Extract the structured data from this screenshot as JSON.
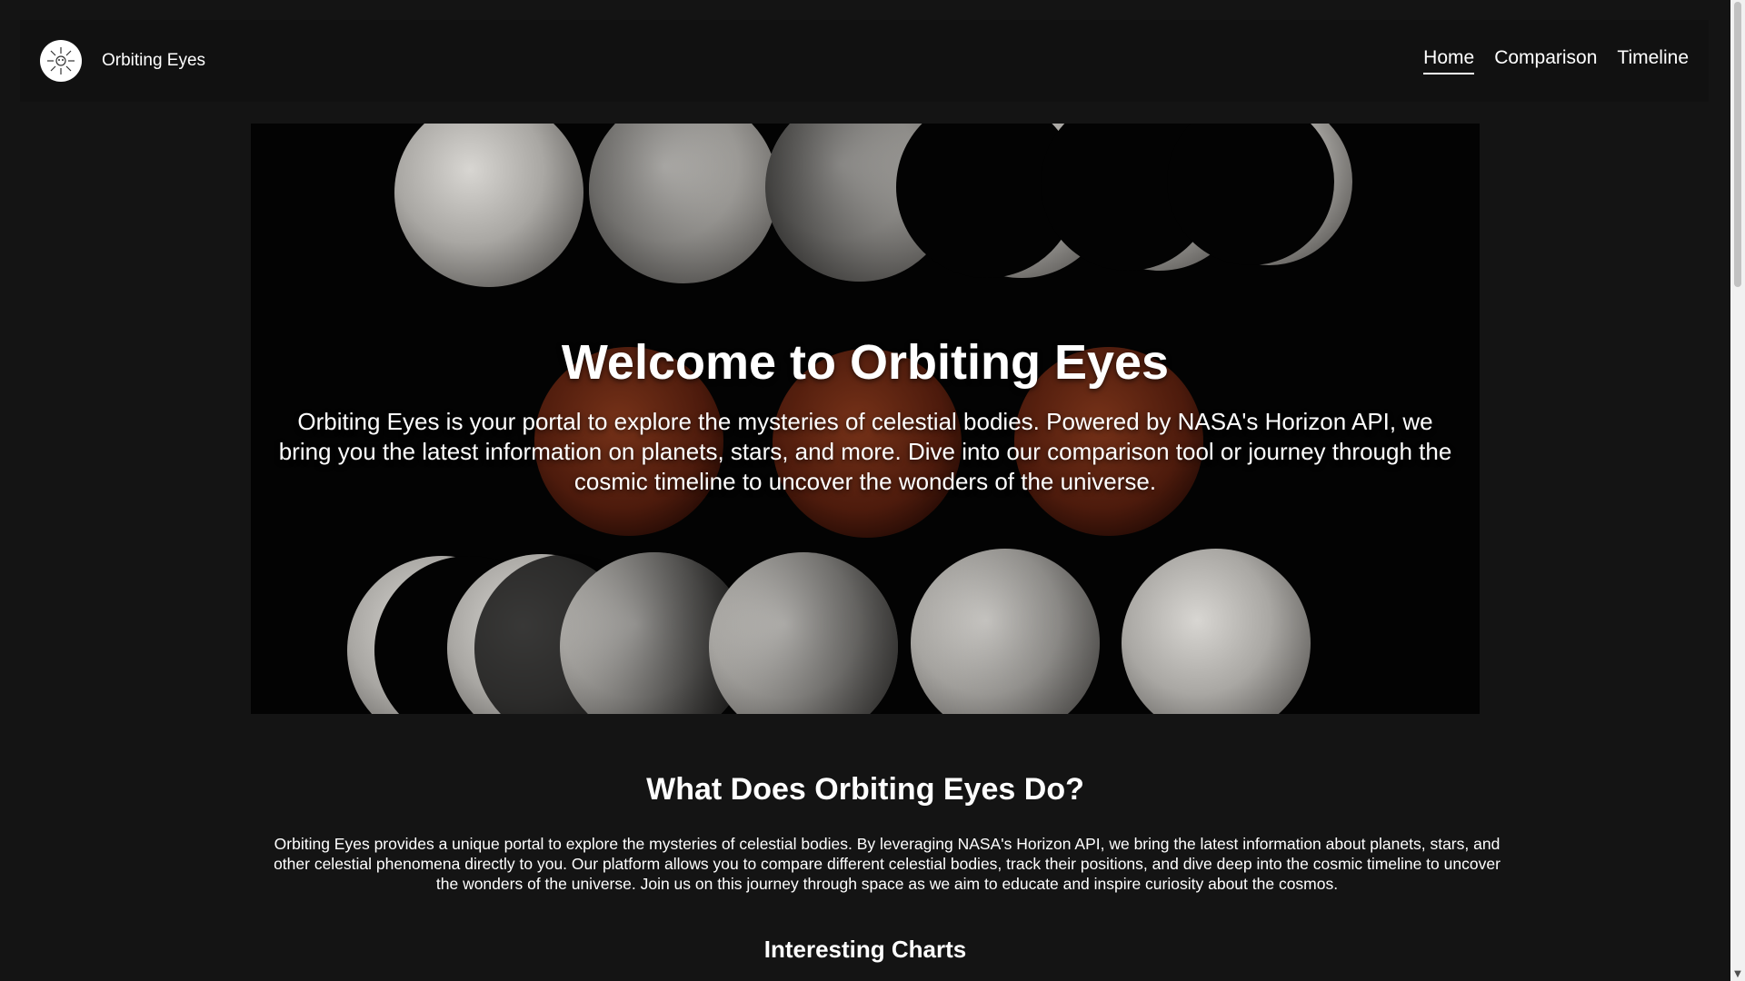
{
  "navbar": {
    "brand_name": "Orbiting Eyes",
    "logo_icon": "sun-emblem-icon",
    "links": [
      {
        "label": "Home",
        "active": true
      },
      {
        "label": "Comparison",
        "active": false
      },
      {
        "label": "Timeline",
        "active": false
      }
    ]
  },
  "hero": {
    "title": "Welcome to Orbiting Eyes",
    "description": "Orbiting Eyes is your portal to explore the mysteries of celestial bodies. Powered by NASA's Horizon API, we bring you the latest information on planets, stars, and more. Dive into our comparison tool or journey through the cosmic timeline to uncover the wonders of the universe.",
    "background_image": "lunar-eclipse-phases-image"
  },
  "about": {
    "title": "What Does Orbiting Eyes Do?",
    "description": "Orbiting Eyes provides a unique portal to explore the mysteries of celestial bodies. By leveraging NASA's Horizon API, we bring the latest information about planets, stars, and other celestial phenomena directly to you. Our platform allows you to compare different celestial bodies, track their positions, and dive deep into the cosmic timeline to uncover the wonders of the universe. Join us on this journey through space as we aim to educate and inspire curiosity about the cosmos."
  },
  "charts": {
    "title": "Interesting Charts"
  },
  "colors": {
    "page_background": "#141414",
    "navbar_background": "#111111",
    "text": "#ffffff"
  }
}
